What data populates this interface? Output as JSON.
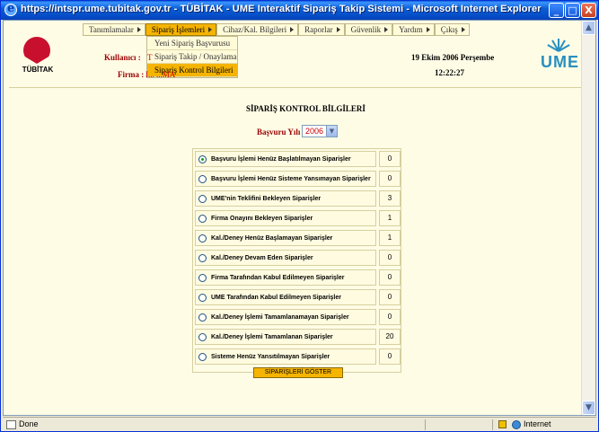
{
  "window": {
    "title": "https://intspr.ume.tubitak.gov.tr - TÜBİTAK - UME Interaktif Sipariş Takip Sistemi - Microsoft Internet Explorer",
    "buttons": [
      "_",
      "□",
      "X"
    ]
  },
  "header": {
    "logo_left": "TÜBİTAK",
    "logo_right": "UME",
    "kullanici_label": "Kullanıcı :",
    "kullanici_value": "T",
    "firma_label": "Firma :",
    "firma_value": "I... ...MA",
    "date": "19 Ekim 2006 Perşembe",
    "time": "12:22:27"
  },
  "menu": {
    "items": [
      {
        "label": "Tanımlamalar",
        "active": false
      },
      {
        "label": "Sipariş İşlemleri",
        "active": true
      },
      {
        "label": "Cihaz/Kal. Bilgileri",
        "active": false
      },
      {
        "label": "Raporlar",
        "active": false
      },
      {
        "label": "Güvenlik",
        "active": false
      },
      {
        "label": "Yardım",
        "active": false
      },
      {
        "label": "Çıkış",
        "active": false
      }
    ],
    "dropdown": [
      {
        "label": "Yeni Sipariş Başvurusu",
        "hover": false
      },
      {
        "label": "Sipariş Takip / Onaylama",
        "hover": false
      },
      {
        "label": "Sipariş Kontrol Bilgileri",
        "hover": true
      }
    ]
  },
  "main": {
    "title": "SİPARİŞ KONTROL BİLGİLERİ",
    "year_label": "Başvuru Yılı :",
    "year_value": "2006",
    "options": [
      {
        "label": "Başvuru İşlemi Henüz Başlatılmayan Siparişler",
        "count": "0",
        "selected": true
      },
      {
        "label": "Başvuru İşlemi Henüz Sisteme Yansımayan Siparişler",
        "count": "0",
        "selected": false
      },
      {
        "label": "UME'nin Teklifini Bekleyen Siparişler",
        "count": "3",
        "selected": false
      },
      {
        "label": "Firma Onayını Bekleyen Siparişler",
        "count": "1",
        "selected": false
      },
      {
        "label": "Kal./Deney Henüz Başlamayan Siparişler",
        "count": "1",
        "selected": false
      },
      {
        "label": "Kal./Deney Devam Eden Siparişler",
        "count": "0",
        "selected": false
      },
      {
        "label": "Firma Tarafından Kabul Edilmeyen Siparişler",
        "count": "0",
        "selected": false
      },
      {
        "label": "UME Tarafından Kabul Edilmeyen Siparişler",
        "count": "0",
        "selected": false
      },
      {
        "label": "Kal./Deney İşlemi Tamamlanamayan Siparişler",
        "count": "0",
        "selected": false
      },
      {
        "label": "Kal./Deney İşlemi Tamamlanan Siparişler",
        "count": "20",
        "selected": false
      },
      {
        "label": "Sisteme Henüz Yansıtılmayan Siparişler",
        "count": "0",
        "selected": false
      }
    ],
    "show_button": "SİPARİŞLERİ GÖSTER"
  },
  "status": {
    "text": "Done",
    "zone": "Internet"
  }
}
